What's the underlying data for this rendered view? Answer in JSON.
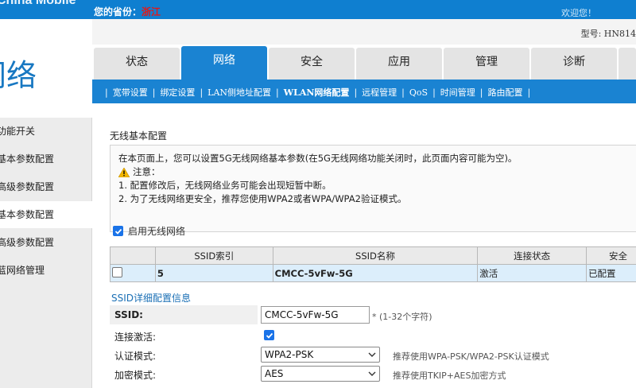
{
  "header": {
    "brand": "China Mobile",
    "identity_label": "您的省份：",
    "identity_value": "浙江",
    "welcome": "欢迎您！",
    "model": "型号: HN814"
  },
  "sidebar": {
    "section_title": "网络",
    "items": [
      {
        "label": "功能开关"
      },
      {
        "label": "基本参数配置"
      },
      {
        "label": "高级参数配置"
      },
      {
        "label": "基本参数配置"
      },
      {
        "label": "高级参数配置"
      },
      {
        "label": "蓝网络管理"
      }
    ]
  },
  "tabs": [
    {
      "label": "状态"
    },
    {
      "label": "网络"
    },
    {
      "label": "安全"
    },
    {
      "label": "应用"
    },
    {
      "label": "管理"
    },
    {
      "label": "诊断"
    }
  ],
  "subnav": [
    {
      "label": "宽带设置"
    },
    {
      "label": "绑定设置"
    },
    {
      "label": "LAN侧地址配置"
    },
    {
      "label": "WLAN网络配置"
    },
    {
      "label": "远程管理"
    },
    {
      "label": "QoS"
    },
    {
      "label": "时间管理"
    },
    {
      "label": "路由配置"
    }
  ],
  "page": {
    "title": "无线基本配置",
    "notice_line1": "在本页面上，您可以设置5G无线网络基本参数(在5G无线网络功能关闭时，此页面内容可能为空)。",
    "notice_warn": "注意：",
    "notice_line2": "1. 配置修改后，无线网络业务可能会出现短暂中断。",
    "notice_line3": "2. 为了无线网络更安全，推荐您使用WPA2或者WPA/WPA2验证模式。",
    "enable_label": "启用无线网络"
  },
  "table": {
    "headers": [
      "",
      "SSID索引",
      "SSID名称",
      "连接状态",
      "安全"
    ],
    "row": [
      "",
      "5",
      "CMCC-5vFw-5G",
      "激活",
      "已配置"
    ]
  },
  "detail": {
    "title": "SSID详细配置信息",
    "ssid_label": "SSID:",
    "ssid_value": "CMCC-5vFw-5G",
    "ssid_hint": "* (1-32个字符)",
    "active_label": "连接激活:",
    "auth_label": "认证模式:",
    "auth_value": "WPA2-PSK",
    "auth_hint": "推荐使用WPA-PSK/WPA2-PSK认证模式",
    "enc_label": "加密模式:",
    "enc_value": "AES",
    "enc_hint": "推荐使用TKIP+AES加密方式"
  },
  "colors": {
    "primary": "#1a83d2",
    "accent_red": "#e21818",
    "table_row": "#dceefb"
  }
}
